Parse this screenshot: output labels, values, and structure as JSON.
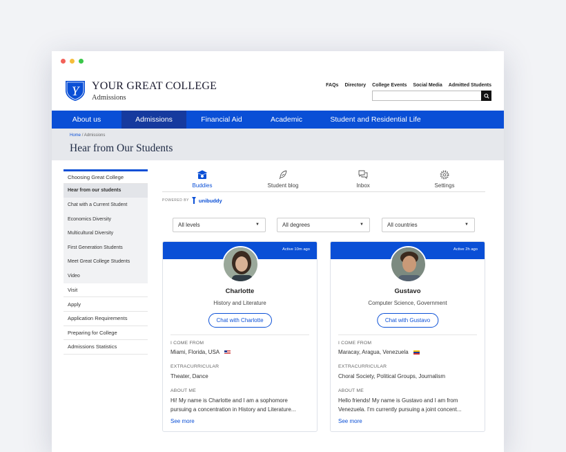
{
  "brand": {
    "name": "YOUR GREAT COLLEGE",
    "subtitle": "Admissions",
    "logo_letter": "Y"
  },
  "utility_links": [
    "FAQs",
    "Directory",
    "College Events",
    "Social Media",
    "Admitted Students"
  ],
  "search": {
    "placeholder": ""
  },
  "nav": [
    "About us",
    "Admissions",
    "Financial Aid",
    "Academic",
    "Student and Residential Life"
  ],
  "nav_active": "Admissions",
  "breadcrumb": {
    "home": "Home",
    "current": "Admissions"
  },
  "page_title": "Hear from Our Students",
  "sidebar": {
    "top": "Choosing Great College",
    "active": "Hear from our students",
    "sub": [
      "Chat with a Current Student",
      "Economics Diversity",
      "Multicultural Diversity",
      "First Generation Students",
      "Meet Great College Students",
      "Video"
    ],
    "items": [
      "Visit",
      "Apply",
      "Application Requirements",
      "Preparing for College",
      "Admissions Statistics"
    ]
  },
  "tabs": [
    {
      "label": "Buddies",
      "icon": "graduation-cap-icon"
    },
    {
      "label": "Student blog",
      "icon": "feather-icon"
    },
    {
      "label": "Inbox",
      "icon": "chat-bubbles-icon"
    },
    {
      "label": "Settings",
      "icon": "gear-icon"
    }
  ],
  "powered_by": {
    "prefix": "POWERED BY",
    "brand": "unibuddy"
  },
  "filters": [
    "All levels",
    "All degrees",
    "All countries"
  ],
  "cards": [
    {
      "active": "Active 10m ago",
      "name": "Charlotte",
      "field": "History and Literature",
      "chat_label": "Chat with Charlotte",
      "from_label": "I COME FROM",
      "from": "Miami, Florida, USA",
      "extra_label": "EXTRACURRICULAR",
      "extra": "Theater, Dance",
      "about_label": "ABOUT ME",
      "about": "Hi! My name is Charlotte and I am a sophomore pursuing a concentration in History and Literature...",
      "see_more": "See more"
    },
    {
      "active": "Active 2h ago",
      "name": "Gustavo",
      "field": "Computer Science, Government",
      "chat_label": "Chat with Gustavo",
      "from_label": "I COME FROM",
      "from": "Maracay, Aragua, Venezuela",
      "extra_label": "EXTRACURRICULAR",
      "extra": "Choral Society, Political Groups, Journalism",
      "about_label": "ABOUT ME",
      "about": "Hello friends! My name is Gustavo and I am from Venezuela. I'm currently pursuing a joint concent...",
      "see_more": "See more"
    }
  ],
  "colors": {
    "primary": "#0a4fd6",
    "nav_active": "#163a9e",
    "hero_bg": "#e6e8ec"
  }
}
